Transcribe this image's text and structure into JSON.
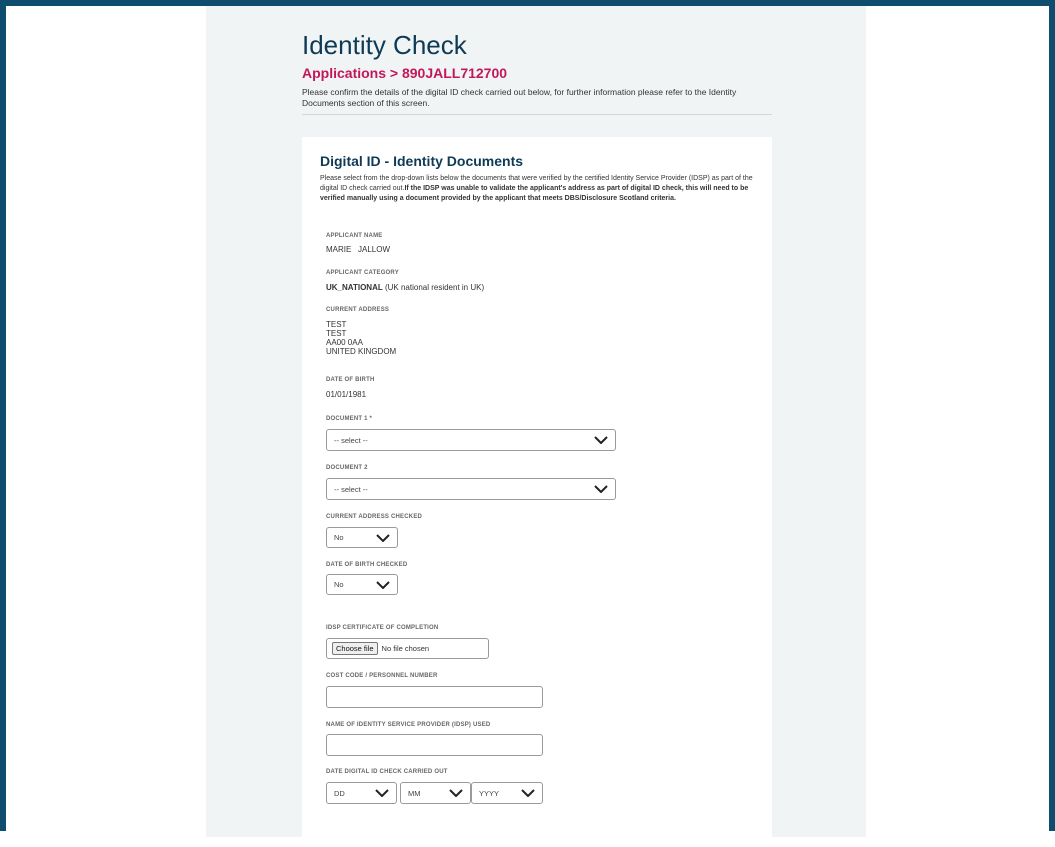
{
  "page": {
    "title": "Identity Check",
    "breadcrumb": "Applications > 890JALL712700",
    "intro": "Please confirm the details of the digital ID check carried out below, for further information please refer to the Identity Documents section of this screen."
  },
  "section": {
    "title": "Digital ID - Identity Documents",
    "desc_plain": "Please select from the drop-down lists below the documents that were verified by the certified Identity Service Provider (IDSP) as part of the digital ID check carried out.",
    "desc_bold": "If the IDSP was unable to validate the applicant's address as part of digital ID check, this will need to be verified manually using a document provided by the applicant that meets DBS/Disclosure Scotland criteria."
  },
  "applicant": {
    "name_label": "APPLICANT NAME",
    "name": "MARIE   JALLOW",
    "category_label": "APPLICANT CATEGORY",
    "category_code": "UK_NATIONAL",
    "category_desc": " (UK national resident in UK)",
    "address_label": "CURRENT ADDRESS",
    "address_lines": [
      "TEST",
      "TEST",
      "AA00 0AA",
      "UNITED KINGDOM"
    ],
    "dob_label": "DATE OF BIRTH",
    "dob": "01/01/1981"
  },
  "form": {
    "doc1_label": "DOCUMENT 1 *",
    "doc1_value": "-- select --",
    "doc2_label": "DOCUMENT 2",
    "doc2_value": "-- select --",
    "address_checked_label": "CURRENT ADDRESS CHECKED",
    "address_checked_value": "No",
    "dob_checked_label": "DATE OF BIRTH CHECKED",
    "dob_checked_value": "No",
    "certificate_label": "IDSP CERTIFICATE OF COMPLETION",
    "choose_file": "Choose file",
    "no_file": "No file chosen",
    "cost_code_label": "COST CODE / PERSONNEL NUMBER",
    "cost_code_value": "",
    "idsp_name_label": "NAME OF IDENTITY SERVICE PROVIDER (IDSP) USED",
    "idsp_name_value": "",
    "check_date_label": "DATE DIGITAL ID CHECK CARRIED OUT",
    "day": "DD",
    "month": "MM",
    "year": "YYYY"
  },
  "icons": {
    "dropdown": "chevron-down-icon"
  },
  "colors": {
    "frame": "#0f4d6e",
    "title": "#0f3a55",
    "breadcrumb": "#c2185b",
    "panel": "#f1f4f5"
  }
}
